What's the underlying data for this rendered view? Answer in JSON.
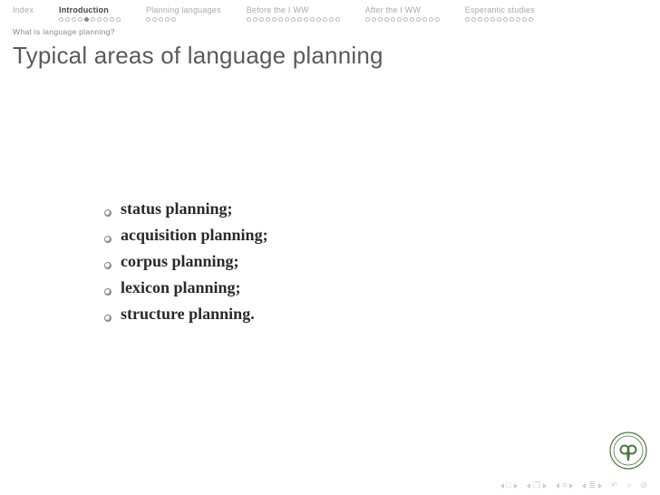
{
  "nav": {
    "sections": [
      {
        "label": "Index",
        "dots": 0,
        "filled_index": -1,
        "current": false
      },
      {
        "label": "Introduction",
        "dots": 10,
        "filled_index": 4,
        "current": true
      },
      {
        "label": "Planning languages",
        "dots": 5,
        "filled_index": -1,
        "current": false
      },
      {
        "label": "Before the I WW",
        "dots": 15,
        "filled_index": -1,
        "current": false
      },
      {
        "label": "After the I WW",
        "dots": 12,
        "filled_index": -1,
        "current": false
      },
      {
        "label": "Esperantic studies",
        "dots": 11,
        "filled_index": -1,
        "current": false
      }
    ]
  },
  "subsection": "What is language planning?",
  "title": "Typical areas of language planning",
  "bullets": [
    "status planning;",
    "acquisition planning;",
    "corpus planning;",
    "lexicon planning;",
    "structure planning."
  ],
  "logo": {
    "alt": "University seal",
    "color": "#4a7a3a"
  },
  "footer_icons": [
    "slide-begin",
    "slide-prev",
    "frame-prev",
    "frame-next",
    "slide-next",
    "slide-end",
    "back",
    "search",
    "fullscreen"
  ]
}
